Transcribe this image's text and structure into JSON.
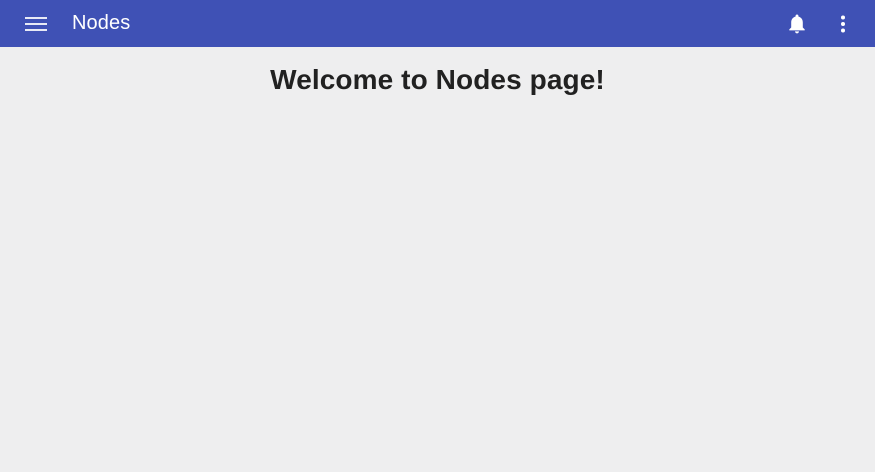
{
  "app_bar": {
    "title": "Nodes",
    "background_color": "#3f51b5",
    "icons": {
      "menu": "hamburger-menu-icon",
      "notifications": "bell-icon",
      "more": "more-vertical-icon"
    }
  },
  "main": {
    "heading": "Welcome to Nodes page!",
    "background_color": "#eeeeef"
  }
}
